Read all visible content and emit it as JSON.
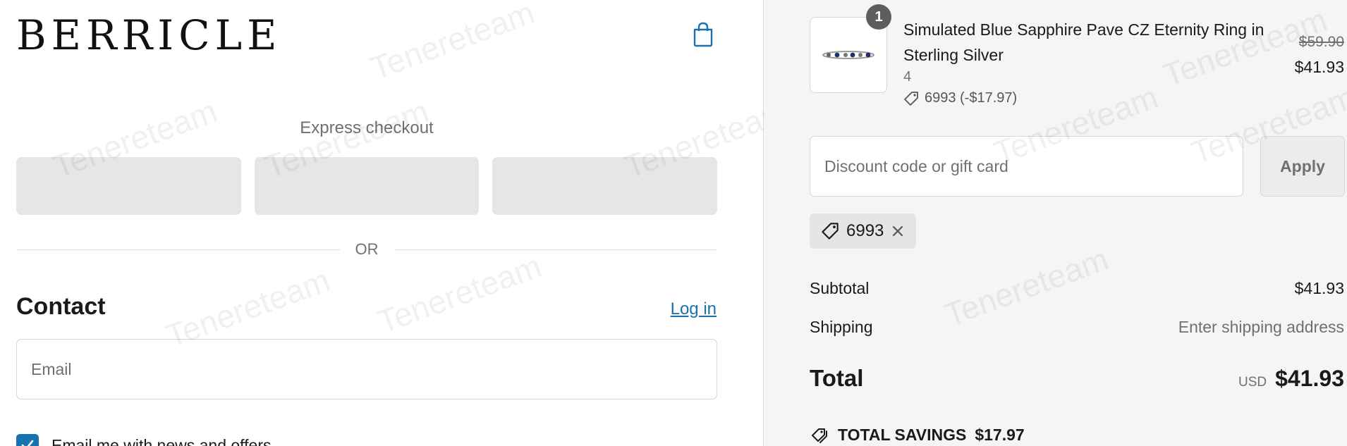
{
  "brand": {
    "logo": "BERRICLE"
  },
  "checkout": {
    "express_title": "Express checkout",
    "or_label": "OR",
    "contact_title": "Contact",
    "login_label": "Log in",
    "email_placeholder": "Email",
    "newsletter_label": "Email me with news and offers",
    "newsletter_checked": true
  },
  "order": {
    "item": {
      "quantity_badge": "1",
      "title": "Simulated Blue Sapphire Pave CZ Eternity Ring in Sterling Silver",
      "variant": "4",
      "discount": "6993 (-$17.97)",
      "price_original": "$59.90",
      "price_final": "$41.93"
    },
    "discount_placeholder": "Discount code or gift card",
    "apply_label": "Apply",
    "applied_code": "6993",
    "subtotal_label": "Subtotal",
    "subtotal_value": "$41.93",
    "shipping_label": "Shipping",
    "shipping_value": "Enter shipping address",
    "total_label": "Total",
    "total_currency": "USD",
    "total_value": "$41.93",
    "savings_label": "TOTAL SAVINGS",
    "savings_value": "$17.97"
  },
  "watermark": "Tenereteam",
  "colors": {
    "link": "#1773b0",
    "checkbox": "#1773b0",
    "summary_bg": "#f5f5f5"
  }
}
